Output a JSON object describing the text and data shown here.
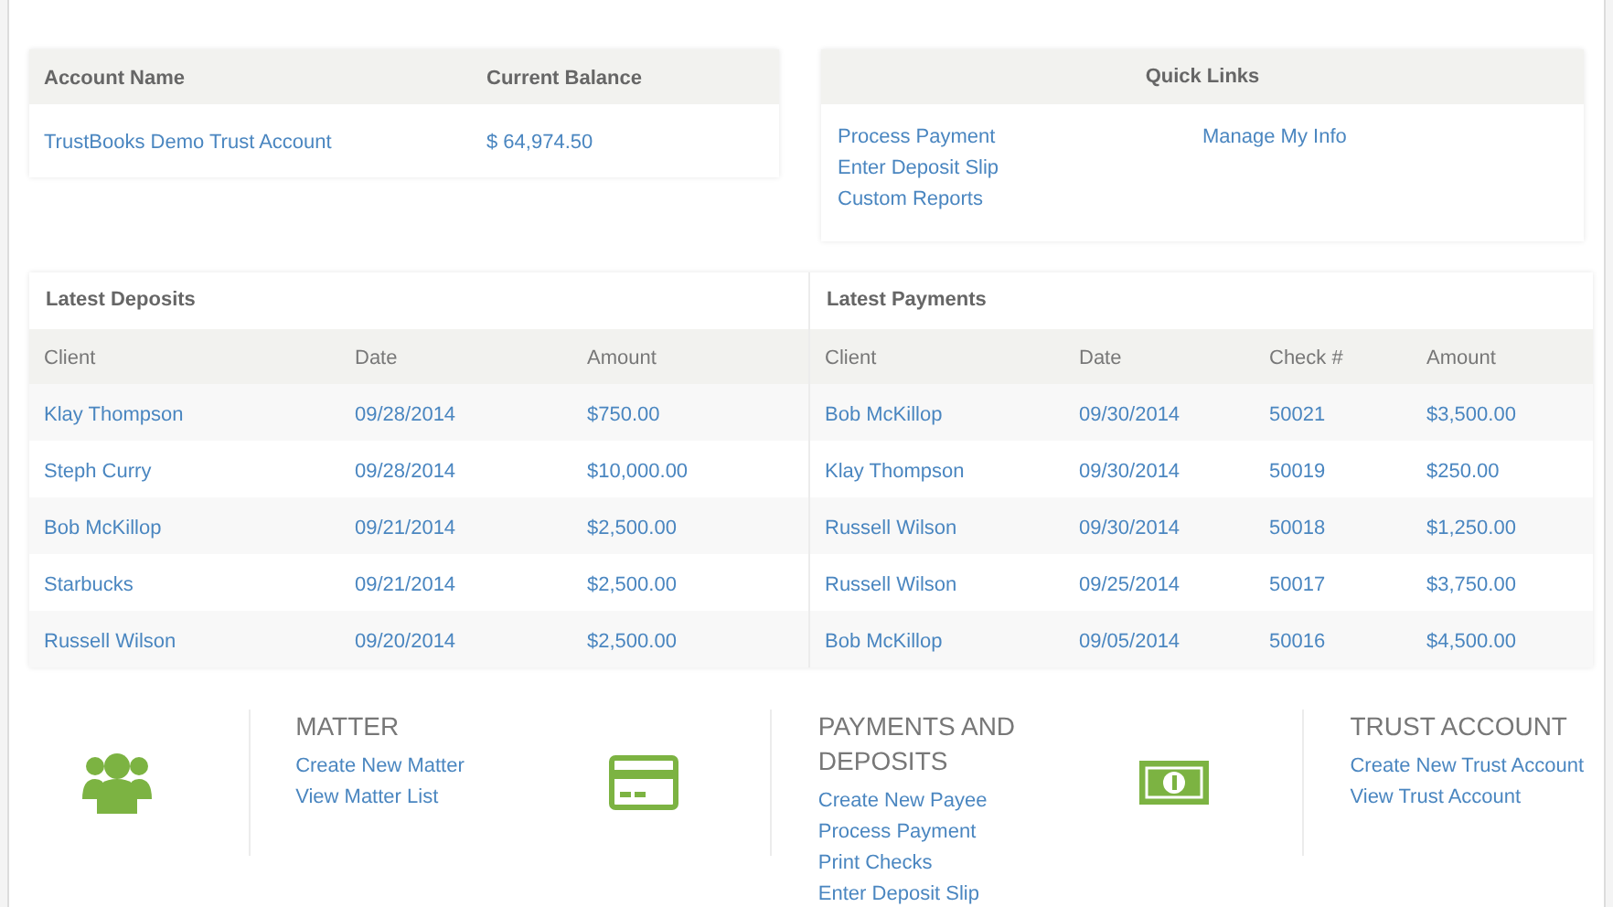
{
  "account_table": {
    "columns": [
      "Account Name",
      "Current Balance"
    ],
    "rows": [
      [
        "TrustBooks Demo Trust Account",
        "$ 64,974.50"
      ]
    ]
  },
  "quick_links": {
    "title": "Quick Links",
    "columns": [
      [
        "Process Payment",
        "Enter Deposit Slip",
        "Custom Reports"
      ],
      [
        "Manage My Info"
      ]
    ]
  },
  "latest_deposits": {
    "title": "Latest Deposits",
    "columns": [
      "Client",
      "Date",
      "Amount"
    ],
    "rows": [
      [
        "Klay Thompson",
        "09/28/2014",
        "$750.00"
      ],
      [
        "Steph Curry",
        "09/28/2014",
        "$10,000.00"
      ],
      [
        "Bob McKillop",
        "09/21/2014",
        "$2,500.00"
      ],
      [
        "Starbucks",
        "09/21/2014",
        "$2,500.00"
      ],
      [
        "Russell Wilson",
        "09/20/2014",
        "$2,500.00"
      ]
    ]
  },
  "latest_payments": {
    "title": "Latest Payments",
    "columns": [
      "Client",
      "Date",
      "Check #",
      "Amount"
    ],
    "rows": [
      [
        "Bob McKillop",
        "09/30/2014",
        "50021",
        "$3,500.00"
      ],
      [
        "Klay Thompson",
        "09/30/2014",
        "50019",
        "$250.00"
      ],
      [
        "Russell Wilson",
        "09/30/2014",
        "50018",
        "$1,250.00"
      ],
      [
        "Russell Wilson",
        "09/25/2014",
        "50017",
        "$3,750.00"
      ],
      [
        "Bob McKillop",
        "09/05/2014",
        "50016",
        "$4,500.00"
      ]
    ]
  },
  "sections": [
    {
      "kind": "people",
      "title": "MATTER",
      "links": [
        "Create New Matter",
        "View Matter List"
      ]
    },
    {
      "kind": "card",
      "title": "PAYMENTS AND DEPOSITS",
      "links": [
        "Create New Payee",
        "Process Payment",
        "Print Checks",
        "Enter Deposit Slip"
      ]
    },
    {
      "kind": "money",
      "title": "TRUST ACCOUNT",
      "links": [
        "Create New Trust Account",
        "View Trust Account"
      ]
    }
  ]
}
